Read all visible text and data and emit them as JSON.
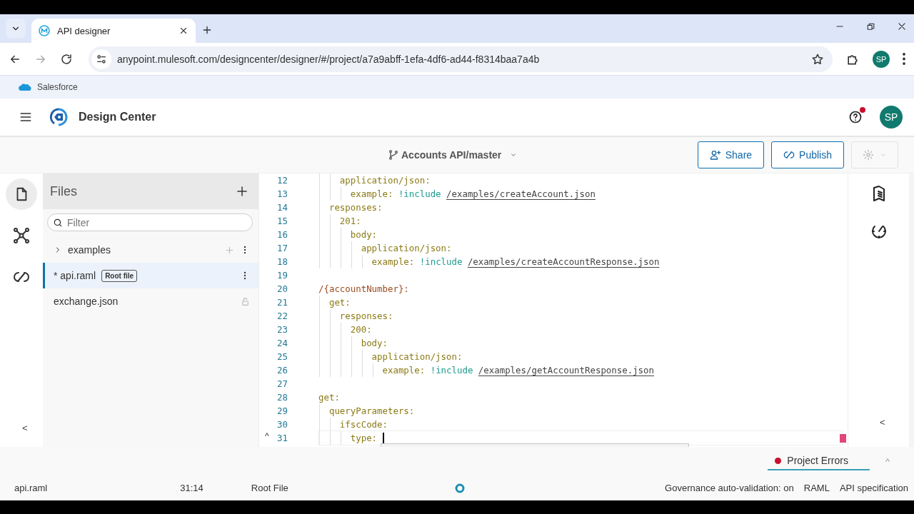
{
  "browser": {
    "tab": {
      "title": "API designer"
    },
    "url": "anypoint.mulesoft.com/designcenter/designer/#/project/a7a9abff-1efa-4df6-ad44-f8314baa7a4b",
    "profile": "SP",
    "bookmarks": [
      {
        "label": "Salesforce"
      }
    ]
  },
  "header": {
    "title": "Design Center",
    "notification": true,
    "avatar": "SP"
  },
  "toolbar": {
    "branch": "Accounts API/master",
    "buttons": [
      "Share",
      "Publish"
    ]
  },
  "rail": [
    {
      "kind": "files",
      "selected": true
    },
    {
      "kind": "graph",
      "selected": false
    },
    {
      "kind": "exchange",
      "selected": false
    }
  ],
  "rail_toggle": "<",
  "files": {
    "title": "Files",
    "filter_placeholder": "Filter",
    "items": [
      {
        "kind": "folder",
        "name": "examples",
        "expanded": false,
        "selected": false
      },
      {
        "kind": "file",
        "name": "* api.raml",
        "badge": "Root file",
        "selected": true
      },
      {
        "kind": "locked",
        "name": "exchange.json",
        "selected": false
      }
    ]
  },
  "editor": {
    "lines": [
      {
        "number": "12",
        "kind": "key",
        "key": "    application/json:"
      },
      {
        "number": "13",
        "kind": "key",
        "key": "      example:",
        "tag": "!include",
        "path": "/examples/createAccount.json"
      },
      {
        "number": "14",
        "kind": "key",
        "key": "  responses:"
      },
      {
        "number": "15",
        "kind": "key",
        "key": "    201:"
      },
      {
        "number": "16",
        "kind": "key",
        "key": "      body:"
      },
      {
        "number": "17",
        "kind": "key",
        "key": "        application/json:"
      },
      {
        "number": "18",
        "kind": "key",
        "key": "          example:",
        "tag": "!include",
        "path": "/examples/createAccountResponse.json"
      },
      {
        "number": "19",
        "kind": "blank"
      },
      {
        "number": "20",
        "kind": "resource",
        "key": "/{accountNumber}:"
      },
      {
        "number": "21",
        "kind": "key",
        "key": "  get:"
      },
      {
        "number": "22",
        "kind": "key",
        "key": "    responses:"
      },
      {
        "number": "23",
        "kind": "key",
        "key": "      200:"
      },
      {
        "number": "24",
        "kind": "key",
        "key": "        body:"
      },
      {
        "number": "25",
        "kind": "key",
        "key": "          application/json:"
      },
      {
        "number": "26",
        "kind": "key",
        "key": "            example:",
        "tag": "!include",
        "path": "/examples/getAccountResponse.json"
      },
      {
        "number": "27",
        "kind": "blank"
      },
      {
        "number": "28",
        "kind": "key",
        "key": "get:"
      },
      {
        "number": "29",
        "kind": "key",
        "key": "  queryParameters:"
      },
      {
        "number": "30",
        "kind": "key",
        "key": "    ifscCode:"
      },
      {
        "number": "31",
        "kind": "key",
        "key": "      type:",
        "current": true,
        "error": true
      }
    ],
    "fold": "^"
  },
  "right_rail_toggle": "<",
  "problems": {
    "label": "Project Errors",
    "error": true,
    "caret": "^"
  },
  "status_bar": {
    "file": "api.raml",
    "position": "31:14",
    "root": "Root File",
    "busy": true,
    "right": [
      "Governance auto-validation: on",
      "RAML",
      "API specification"
    ]
  }
}
